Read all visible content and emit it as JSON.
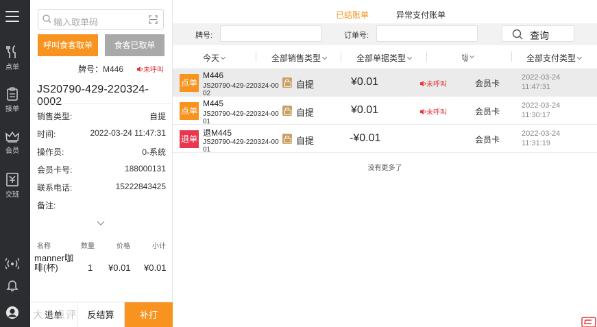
{
  "nav": {
    "items": [
      {
        "label": "点单",
        "icon": "fork-knife-icon"
      },
      {
        "label": "接单",
        "icon": "clipboard-icon"
      },
      {
        "label": "会员",
        "icon": "crown-icon"
      },
      {
        "label": "交班",
        "icon": "cash-register-icon"
      }
    ]
  },
  "detail": {
    "scan_placeholder": "输入取单码",
    "call_button": "呼叫食客取单",
    "taken_button": "食客已取单",
    "plate_label": "牌号：M446",
    "call_status": "未呼叫",
    "order_no": "JS20790-429-220324-0002",
    "fields": [
      {
        "k": "销售类型:",
        "v": "自提"
      },
      {
        "k": "时间:",
        "v": "2022-03-24 11:47:31"
      },
      {
        "k": "操作员:",
        "v": "0-系统"
      },
      {
        "k": "会员卡号:",
        "v": "188000131"
      },
      {
        "k": "联系电话:",
        "v": "15222843425"
      },
      {
        "k": "备注:",
        "v": ""
      }
    ],
    "items_header": {
      "name": "名称",
      "qty": "数量",
      "price": "价格",
      "subtotal": "小计"
    },
    "items": [
      {
        "name": "manner咖啡(杯)",
        "qty": "1",
        "price": "¥0.01",
        "subtotal": "¥0.01"
      }
    ],
    "actions": {
      "refund": "退单",
      "unsettle": "反结算",
      "reprint": "补打"
    }
  },
  "main": {
    "tabs": {
      "settled": "已结账单",
      "abnormal": "异常支付账单"
    },
    "filters": {
      "plate_label": "牌号:",
      "order_label": "订单号:",
      "query": "查询"
    },
    "dropdowns": {
      "date": "今天",
      "sale_type": "全部销售类型",
      "doc_type": "全部单据类型",
      "operator": "tjj",
      "pay_type": "全部支付类型"
    },
    "orders": [
      {
        "badge": "点单",
        "kind": "order",
        "plate": "M446",
        "order_no": "JS20790-429-220324-0002",
        "sale_type": "自提",
        "amount": "¥0.01",
        "call": "未呼叫",
        "pay": "会员卡",
        "date": "2022-03-24",
        "time": "11:47:31"
      },
      {
        "badge": "点单",
        "kind": "order",
        "plate": "M445",
        "order_no": "JS20790-429-220324-0001",
        "sale_type": "自提",
        "amount": "¥0.01",
        "call": "未呼叫",
        "pay": "会员卡",
        "date": "2022-03-24",
        "time": "11:30:17"
      },
      {
        "badge": "退单",
        "kind": "refund",
        "plate": "退M445",
        "order_no": "JS20790-429-220324-0001",
        "sale_type": "自提",
        "amount": "-¥0.01",
        "call": "",
        "pay": "会员卡",
        "date": "2022-03-24",
        "time": "11:31:19"
      }
    ],
    "no_more": "没有更多了"
  },
  "watermark": "大众点评",
  "colors": {
    "accent": "#f7931e",
    "refund": "#e8384f",
    "nav_bg": "#2b2d30",
    "warn": "#e4393c"
  }
}
